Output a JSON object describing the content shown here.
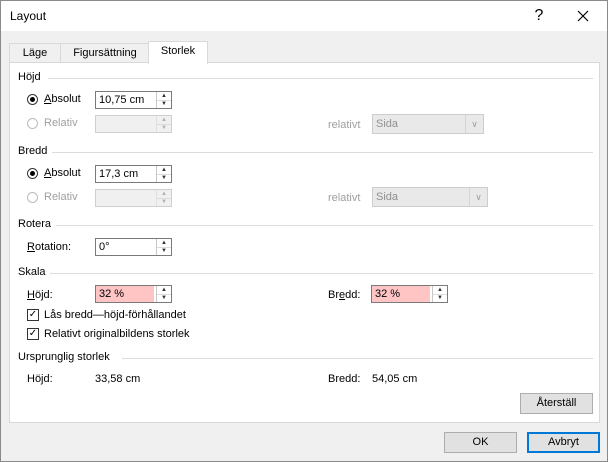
{
  "window": {
    "title": "Layout",
    "help_label": "?",
    "close_label": "✕"
  },
  "tabs": [
    {
      "label": "Läge"
    },
    {
      "label": "Figursättning"
    },
    {
      "label": "Storlek"
    }
  ],
  "height": {
    "section": "Höjd",
    "absolute_label": "Absolut",
    "absolute_value": "10,75 cm",
    "relative_label": "Relativ",
    "relative_value": "",
    "relative_to_label": "relativt",
    "relative_to_value": "Sida"
  },
  "width": {
    "section": "Bredd",
    "absolute_label": "Absolut",
    "absolute_value": "17,3 cm",
    "relative_label": "Relativ",
    "relative_value": "",
    "relative_to_label": "relativt",
    "relative_to_value": "Sida"
  },
  "rotate": {
    "section": "Rotera",
    "rotation_label": "Rotation:",
    "rotation_value": "0°"
  },
  "scale": {
    "section": "Skala",
    "height_label": "Höjd:",
    "height_value": "32 %",
    "width_label": "Bredd:",
    "width_value": "32 %",
    "lock_aspect_label": "Lås bredd—höjd-förhållandet",
    "lock_aspect_checked": true,
    "relative_original_label": "Relativt originalbildens storlek",
    "relative_original_checked": true
  },
  "original": {
    "section": "Ursprunglig storlek",
    "height_label": "Höjd:",
    "height_value": "33,58 cm",
    "width_label": "Bredd:",
    "width_value": "54,05 cm",
    "reset_label": "Återställ"
  },
  "footer": {
    "ok_label": "OK",
    "cancel_label": "Avbryt"
  },
  "colors": {
    "accent": "#0078d7",
    "invalid_field": "#ffc4c4"
  }
}
